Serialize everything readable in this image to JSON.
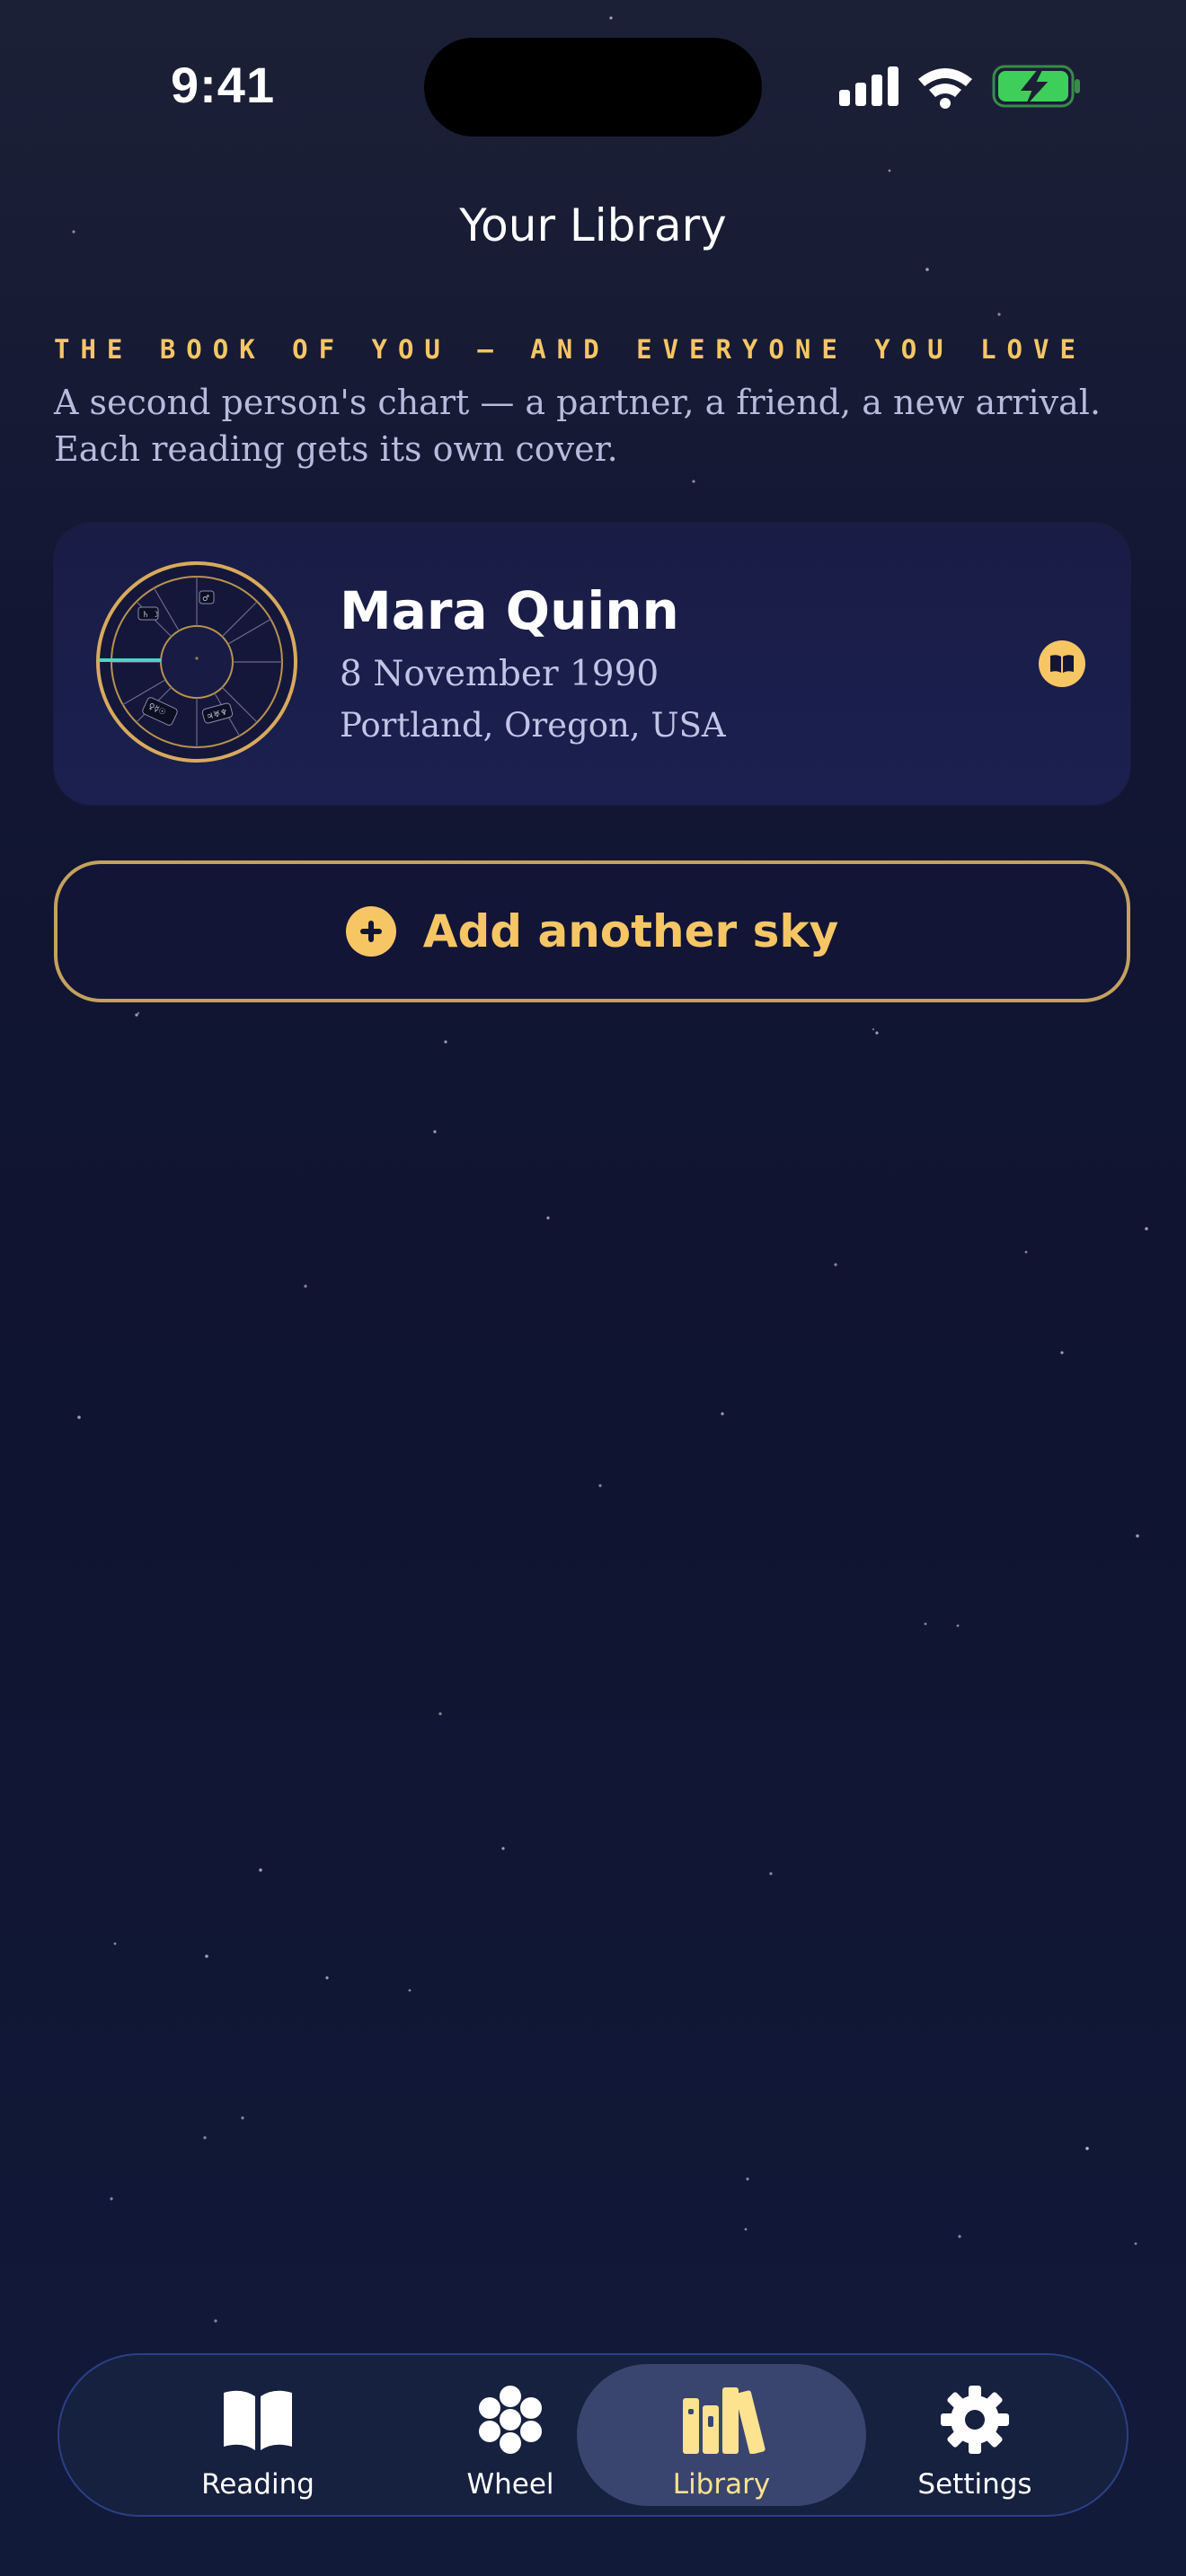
{
  "status_bar": {
    "time": "9:41"
  },
  "header": {
    "title": "Your Library"
  },
  "intro": {
    "eyebrow": "THE BOOK OF YOU — AND EVERYONE YOU LOVE",
    "body": "A second person's chart — a partner, a friend, a new arrival. Each reading gets its own cover."
  },
  "profile": {
    "name": "Mara Quinn",
    "date": "8 November 1990",
    "place": "Portland, Oregon, USA"
  },
  "add_button": {
    "label": "Add another sky"
  },
  "tab_bar": {
    "tabs": [
      {
        "label": "Reading",
        "icon": "open-book-icon",
        "active": false
      },
      {
        "label": "Wheel",
        "icon": "flower-icon",
        "active": false
      },
      {
        "label": "Library",
        "icon": "books-icon",
        "active": true
      },
      {
        "label": "Settings",
        "icon": "gear-icon",
        "active": false
      }
    ]
  },
  "colors": {
    "accent": "#f6c665",
    "background": "#121633",
    "card": "#1a1e4a",
    "active_tab": "#39456e",
    "battery": "#3ecf5a"
  }
}
